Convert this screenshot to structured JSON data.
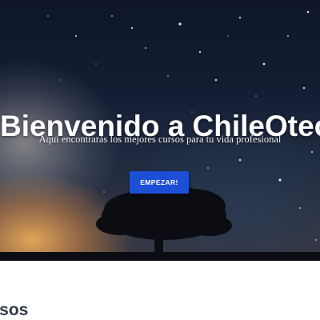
{
  "hero": {
    "title": "Bienvenido a ChileOtec!",
    "subtitle": "Aqui encontrarás los mejores cursos para tu vida profesional",
    "cta_label": "EMPEZAR!"
  },
  "courses_section": {
    "title": "Cursos",
    "visible_title": "rsos"
  },
  "colors": {
    "cta": "#1d4fd6",
    "section_title": "#2f3a4a"
  }
}
